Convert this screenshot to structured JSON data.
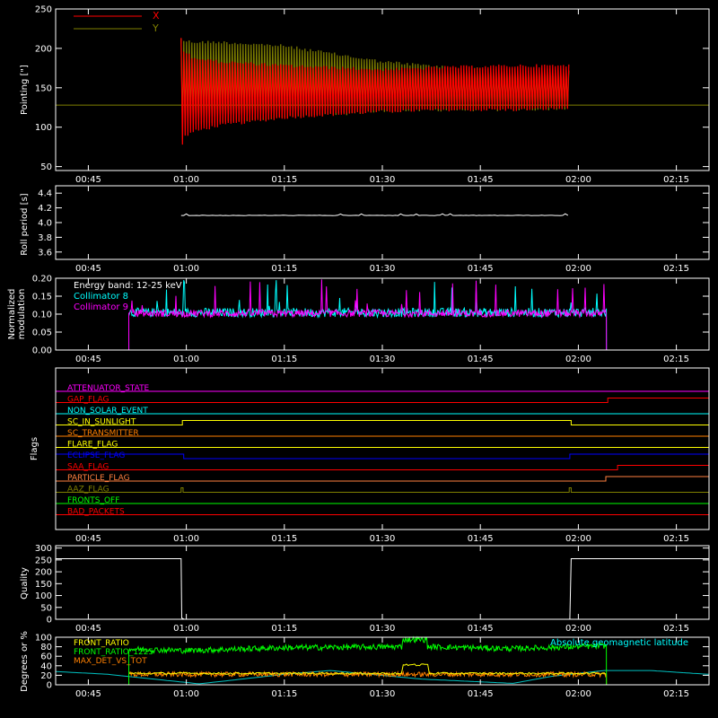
{
  "time_axis": {
    "range": [
      40,
      140
    ],
    "tick_values": [
      45,
      60,
      75,
      90,
      105,
      120,
      135
    ],
    "tick_labels": [
      "00:45",
      "01:00",
      "01:15",
      "01:30",
      "01:45",
      "02:00",
      "02:15"
    ]
  },
  "chart_data": [
    {
      "id": "pointing",
      "type": "line",
      "ylabel": "Pointing [\"]",
      "ylim": [
        45,
        250
      ],
      "yticks": [
        50,
        100,
        150,
        200,
        250
      ],
      "baseline": 128,
      "legend_position": "top-left",
      "series": [
        {
          "name": "X",
          "color": "#ff0000",
          "t_start": 59.2,
          "t_end": 118.7,
          "envelope_t": [
            59.2,
            59.6,
            61,
            65,
            75,
            90,
            100,
            110,
            118.7
          ],
          "upper": [
            215,
            200,
            190,
            185,
            180,
            175,
            178,
            180,
            180
          ],
          "lower": [
            70,
            85,
            92,
            100,
            110,
            118,
            120,
            120,
            122
          ]
        },
        {
          "name": "Y",
          "color": "#808000",
          "t_start": 59.2,
          "t_end": 118.7,
          "envelope_t": [
            59.2,
            59.6,
            61,
            65,
            75,
            90,
            100,
            110,
            118.7
          ],
          "upper": [
            215,
            212,
            210,
            210,
            205,
            185,
            178,
            175,
            175
          ],
          "lower": [
            100,
            100,
            102,
            105,
            110,
            118,
            120,
            120,
            122
          ]
        }
      ]
    },
    {
      "id": "roll",
      "type": "line",
      "ylabel": "Roll period [s]",
      "ylim": [
        3.5,
        4.5
      ],
      "yticks": [
        3.6,
        3.8,
        4.0,
        4.2,
        4.4
      ],
      "ytick_labels": [
        "3.6",
        "3.8",
        "4.0",
        "4.2",
        "4.4"
      ],
      "series": [
        {
          "name": "",
          "color": "#ffffff",
          "t_start": 59.2,
          "t_end": 118.7,
          "value": 4.1
        }
      ]
    },
    {
      "id": "modulation",
      "type": "line",
      "ylabel": "Normalized modulation",
      "ylim": [
        0,
        0.2
      ],
      "yticks": [
        0,
        0.05,
        0.1,
        0.15,
        0.2
      ],
      "ytick_labels": [
        "0.00",
        "0.05",
        "0.10",
        "0.15",
        "0.20"
      ],
      "annotation": "Energy band: 12-25 keV",
      "active_range": [
        51.2,
        124.3
      ],
      "series": [
        {
          "name": "Collimator 8",
          "color": "#00ffff",
          "mean": 0.1,
          "spread": 0.025
        },
        {
          "name": "Collimator 9",
          "color": "#ff00ff",
          "mean": 0.1,
          "spread": 0.02
        }
      ]
    },
    {
      "id": "flags",
      "type": "line",
      "ylabel": "Flags",
      "flags": [
        {
          "name": "ATTENUATOR_STATE",
          "color": "#ff00ff",
          "transitions": []
        },
        {
          "name": "GAP_FLAG",
          "color": "#ff0000",
          "transitions": [
            124.5
          ]
        },
        {
          "name": "NON_SOLAR_EVENT",
          "color": "#00ffff",
          "transitions": []
        },
        {
          "name": "SC_IN_SUNLIGHT",
          "color": "#ffff00",
          "transitions": [
            59.4,
            118.9
          ],
          "initial": 0
        },
        {
          "name": "SC_TRANSMITTER",
          "color": "#ff8000",
          "transitions": []
        },
        {
          "name": "FLARE_FLAG",
          "color": "#ffff00",
          "transitions": []
        },
        {
          "name": "ECLIPSE_FLAG",
          "color": "#0000ff",
          "transitions": [
            59.6,
            118.7
          ],
          "initial": 1
        },
        {
          "name": "SAA_FLAG",
          "color": "#ff0000",
          "transitions": [
            126.0
          ]
        },
        {
          "name": "PARTICLE_FLAG",
          "color": "#ff8040",
          "transitions": [
            124.2
          ]
        },
        {
          "name": "AAZ_FLAG",
          "color": "#808000",
          "transitions": [
            59.2,
            59.5,
            118.6,
            118.9
          ]
        },
        {
          "name": "FRONTS_OFF",
          "color": "#00ff00",
          "transitions": []
        },
        {
          "name": "BAD_PACKETS",
          "color": "#ff0000",
          "transitions": []
        }
      ]
    },
    {
      "id": "quality",
      "type": "line",
      "ylabel": "Quality",
      "ylim": [
        0,
        310
      ],
      "yticks": [
        0,
        50,
        100,
        150,
        200,
        250,
        300
      ],
      "series": [
        {
          "name": "",
          "color": "#ffffff",
          "x": [
            40,
            59.2,
            59.3,
            59.7,
            118.7,
            118.9,
            140
          ],
          "y": [
            255,
            255,
            5,
            0,
            0,
            255,
            255
          ]
        }
      ]
    },
    {
      "id": "ratios",
      "type": "line",
      "ylabel": "Degrees or %",
      "ylim": [
        0,
        100
      ],
      "yticks": [
        0,
        20,
        40,
        60,
        80,
        100
      ],
      "series": [
        {
          "name": "FRONT_RATIO",
          "color": "#ffff00"
        },
        {
          "name": "FRONT_RATIO_1225",
          "color": "#00ff00"
        },
        {
          "name": "MAX_DET_VS_TOT",
          "color": "#ff8000"
        },
        {
          "name": "Absolute geomagnetic latitude",
          "color": "#00c0c0"
        }
      ]
    }
  ]
}
